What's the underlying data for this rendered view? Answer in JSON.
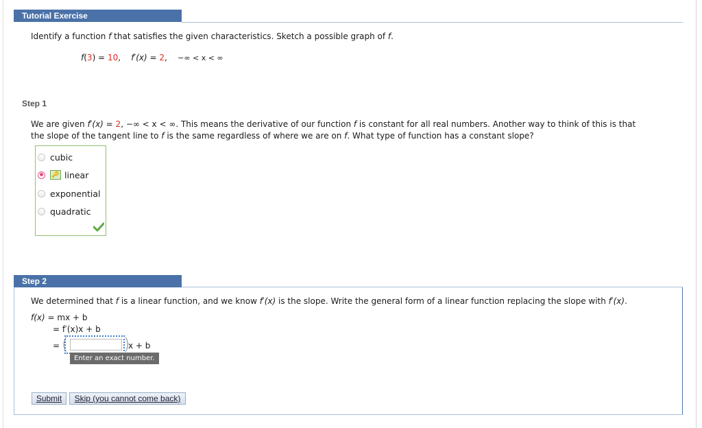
{
  "header": {
    "title": "Tutorial Exercise"
  },
  "prompt": {
    "text_before": "Identify a function ",
    "f": "f",
    "text_after": " that satisfies the given characteristics. Sketch a possible graph of ",
    "f2": "f",
    "end": "."
  },
  "given": {
    "f_label": "f",
    "f_arg": "3",
    "f_value": "10",
    "fprime_label": "f′(x)",
    "fprime_value": "2",
    "domain": "−∞ < x < ∞"
  },
  "step1": {
    "label": "Step 1",
    "line1_a": "We are given ",
    "line1_fp": "f′(x)",
    "line1_eq": " = ",
    "line1_val": "2",
    "line1_b": ", −∞ < x < ∞. This means the derivative of our function ",
    "line1_f": "f",
    "line1_c": " is constant for all real numbers. Another way to think of this is that",
    "line2_a": "the slope of the tangent line to ",
    "line2_f": "f",
    "line2_b": " is the same regardless of where we are on ",
    "line2_f2": "f",
    "line2_c": ". What type of function has a constant slope?",
    "choices": [
      {
        "label": "cubic",
        "selected": false
      },
      {
        "label": "linear",
        "selected": true
      },
      {
        "label": "exponential",
        "selected": false
      },
      {
        "label": "quadratic",
        "selected": false
      }
    ],
    "status": "correct"
  },
  "step2": {
    "label": "Step 2",
    "intro_a": "We determined that ",
    "intro_f": "f",
    "intro_b": " is a linear function, and we know ",
    "intro_fp": "f′(x)",
    "intro_c": " is the slope. Write the general form of a linear function replacing the slope with ",
    "intro_fp2": "f′(x)",
    "intro_d": ".",
    "row1_lhs": "f(x)",
    "row1_rhs": "= mx + b",
    "row2_rhs": "= f′(x)x + b",
    "row3_eq": "=",
    "row3_tail": "x + b",
    "answer_value": "",
    "tooltip": "Enter an exact number."
  },
  "buttons": {
    "submit": "Submit",
    "skip": "Skip (you cannot come back)"
  }
}
